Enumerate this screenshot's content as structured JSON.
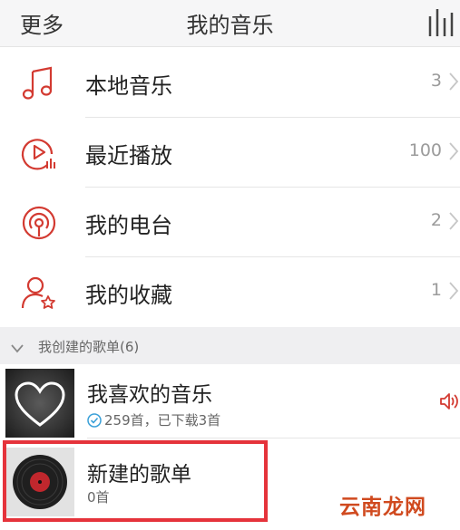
{
  "header": {
    "more_label": "更多",
    "title": "我的音乐"
  },
  "menu": [
    {
      "label": "本地音乐",
      "count": "3",
      "icon": "music-note-icon"
    },
    {
      "label": "最近播放",
      "count": "100",
      "icon": "recent-play-icon"
    },
    {
      "label": "我的电台",
      "count": "2",
      "icon": "radio-icon"
    },
    {
      "label": "我的收藏",
      "count": "1",
      "icon": "favorites-icon"
    }
  ],
  "section": {
    "title": "我创建的歌单(6)"
  },
  "playlists": [
    {
      "name": "我喜欢的音乐",
      "subtitle": "259首，已下载3首",
      "cover_icon": "heart-icon"
    },
    {
      "name": "新建的歌单",
      "subtitle": "0首",
      "cover_icon": "vinyl-record-icon"
    }
  ],
  "watermark": "云南龙网",
  "colors": {
    "accent": "#d33a31",
    "highlight_border": "#e5333b",
    "download_check": "#3aa0d8"
  }
}
